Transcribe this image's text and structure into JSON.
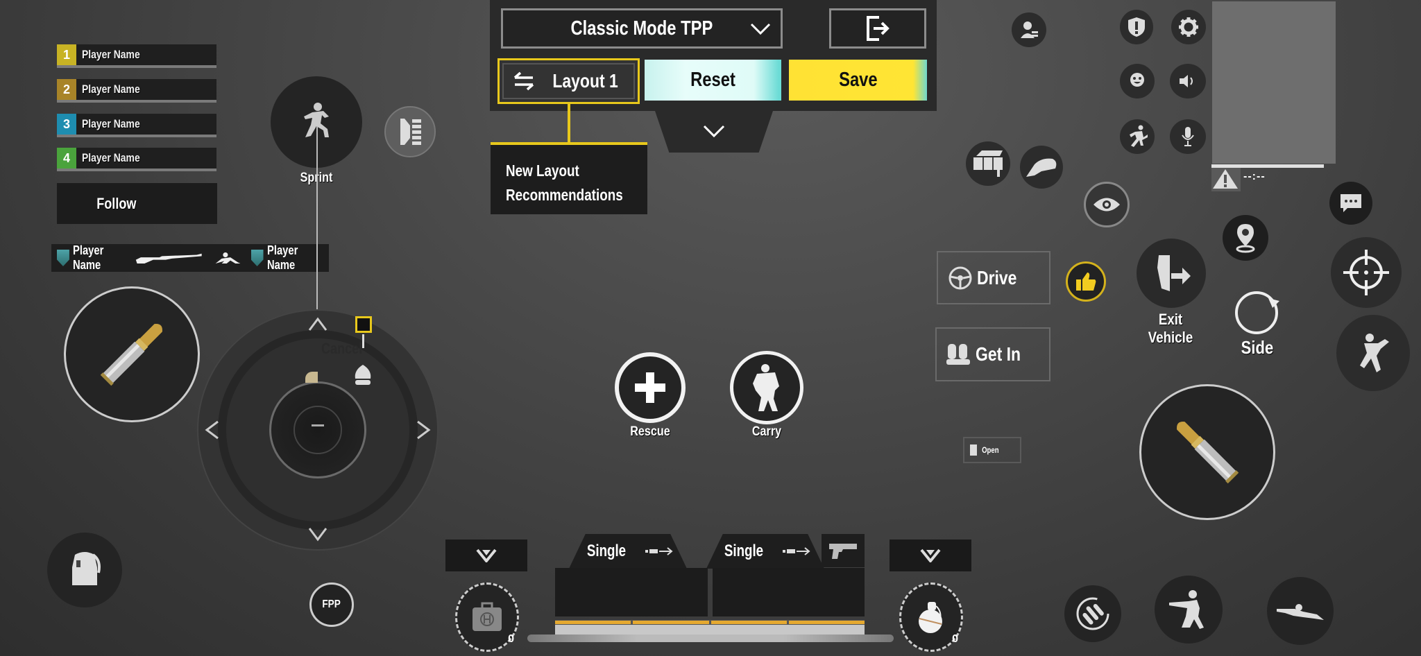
{
  "top_bar": {
    "mode_select": {
      "value": "Classic Mode TPP",
      "icon": "chevron-down-icon"
    },
    "exit_icon": "exit-door-icon",
    "layout_button": {
      "label": "Layout 1",
      "icon": "swap-arrows-icon"
    },
    "reset_label": "Reset",
    "save_label": "Save",
    "expand_icon": "chevron-down-icon",
    "tooltip_lines": [
      "New Layout",
      "Recommendations"
    ]
  },
  "team": {
    "members": [
      {
        "number": "1",
        "name": "Player Name",
        "color": "#c8b324"
      },
      {
        "number": "2",
        "name": "Player Name",
        "color": "#a88428"
      },
      {
        "number": "3",
        "name": "Player Name",
        "color": "#1e8db0"
      },
      {
        "number": "4",
        "name": "Player Name",
        "color": "#4aa33c"
      }
    ],
    "follow_label": "Follow"
  },
  "killfeed": {
    "killer": "Player Name",
    "victim": "Player Name",
    "weapon_icon": "rifle-icon",
    "action_icon": "knocked-down-icon"
  },
  "controls": {
    "sprint_label": "Sprint",
    "cancel_label": "Cancel",
    "rescue_label": "Rescue",
    "carry_label": "Carry",
    "drive_label": "Drive",
    "get_in_label": "Get In",
    "open_label": "Open",
    "exit_vehicle_label": "Exit Vehicle",
    "side_label": "Side",
    "fpp_label": "FPP"
  },
  "minimap": {
    "time": "--:--"
  },
  "weapons": {
    "slot1": {
      "fire_mode": "Single"
    },
    "slot2": {
      "fire_mode": "Single",
      "sidearm_icon": "pistol-icon"
    },
    "heal_count": "0",
    "throwable_count": "0"
  },
  "colors": {
    "accent_yellow": "#e8c81c",
    "save_yellow": "#ffe234",
    "reset_cyan": "#dffbf7",
    "ammo_orange": "#e5a930"
  }
}
